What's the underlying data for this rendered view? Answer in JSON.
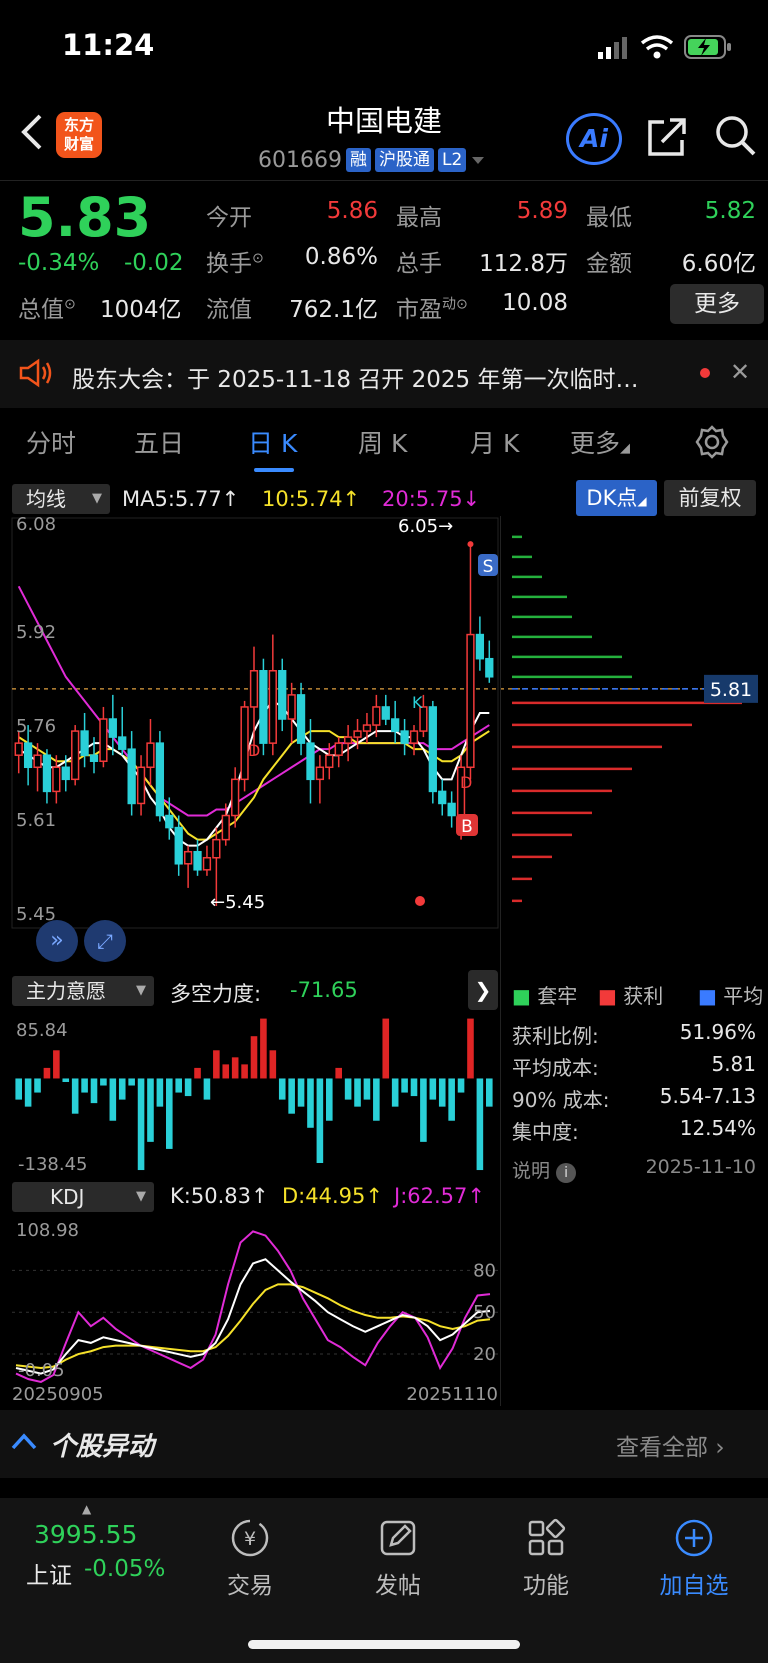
{
  "status": {
    "time": "11:24"
  },
  "header": {
    "logo_line1": "东方",
    "logo_line2": "财富",
    "title": "中国电建",
    "code": "601669",
    "tags": [
      "融",
      "沪股通",
      "L2"
    ],
    "ai_label": "Ai"
  },
  "quote": {
    "price": "5.83",
    "change_pct": "-0.34%",
    "change": "-0.02",
    "mktcap_label": "总值",
    "mktcap_value": "1004亿",
    "open_label": "今开",
    "open_value": "5.86",
    "high_label": "最高",
    "high_value": "5.89",
    "low_label": "最低",
    "low_value": "5.82",
    "turnover_label": "换手",
    "turnover_value": "0.86%",
    "volume_label": "总手",
    "volume_value": "112.8万",
    "amount_label": "金额",
    "amount_value": "6.60亿",
    "float_label": "流值",
    "float_value": "762.1亿",
    "pe_label": "市盈",
    "pe_sup": "动",
    "pe_value": "10.08",
    "more_label": "更多"
  },
  "announcement": {
    "text": "股东大会：于 2025-11-18 召开 2025 年第一次临时…"
  },
  "tabs": [
    "分时",
    "五日",
    "日 K",
    "周 K",
    "月 K",
    "更多"
  ],
  "active_tab": "日 K",
  "ma_row": {
    "indicator": "均线",
    "ma5": "MA5:5.77↑",
    "ma10": "10:5.74↑",
    "ma20": "20:5.75↓",
    "dk_label": "DK点",
    "fq_label": "前复权"
  },
  "main_chart_labels": {
    "y_ticks": [
      "6.08",
      "5.92",
      "5.76",
      "5.61",
      "5.45"
    ],
    "high_marker": "6.05→",
    "low_marker": "←5.45",
    "avg_cost_tag": "5.81",
    "k_marker": "K",
    "d_marker": "D",
    "s_marker": "S",
    "b_marker": "B"
  },
  "chart_data": {
    "type": "candlestick",
    "dates": [
      "20250905",
      "20251110"
    ],
    "ylim": [
      5.45,
      6.08
    ],
    "ohlc": [
      [
        5.7,
        5.74,
        5.67,
        5.72
      ],
      [
        5.72,
        5.75,
        5.65,
        5.68
      ],
      [
        5.68,
        5.72,
        5.64,
        5.7
      ],
      [
        5.7,
        5.71,
        5.62,
        5.64
      ],
      [
        5.64,
        5.7,
        5.62,
        5.68
      ],
      [
        5.68,
        5.7,
        5.64,
        5.66
      ],
      [
        5.66,
        5.75,
        5.65,
        5.74
      ],
      [
        5.74,
        5.77,
        5.68,
        5.7
      ],
      [
        5.7,
        5.73,
        5.67,
        5.69
      ],
      [
        5.69,
        5.78,
        5.68,
        5.76
      ],
      [
        5.76,
        5.8,
        5.7,
        5.73
      ],
      [
        5.73,
        5.78,
        5.7,
        5.71
      ],
      [
        5.71,
        5.74,
        5.6,
        5.62
      ],
      [
        5.62,
        5.7,
        5.6,
        5.68
      ],
      [
        5.68,
        5.76,
        5.65,
        5.72
      ],
      [
        5.72,
        5.74,
        5.59,
        5.6
      ],
      [
        5.6,
        5.63,
        5.56,
        5.58
      ],
      [
        5.58,
        5.6,
        5.5,
        5.52
      ],
      [
        5.52,
        5.55,
        5.48,
        5.54
      ],
      [
        5.54,
        5.56,
        5.5,
        5.51
      ],
      [
        5.51,
        5.55,
        5.5,
        5.53
      ],
      [
        5.53,
        5.58,
        5.45,
        5.56
      ],
      [
        5.56,
        5.62,
        5.55,
        5.6
      ],
      [
        5.6,
        5.68,
        5.58,
        5.66
      ],
      [
        5.66,
        5.79,
        5.64,
        5.78
      ],
      [
        5.78,
        5.88,
        5.7,
        5.84
      ],
      [
        5.84,
        5.86,
        5.7,
        5.72
      ],
      [
        5.72,
        5.9,
        5.7,
        5.84
      ],
      [
        5.84,
        5.86,
        5.74,
        5.76
      ],
      [
        5.76,
        5.82,
        5.72,
        5.8
      ],
      [
        5.8,
        5.82,
        5.7,
        5.72
      ],
      [
        5.72,
        5.76,
        5.62,
        5.66
      ],
      [
        5.66,
        5.7,
        5.62,
        5.68
      ],
      [
        5.68,
        5.72,
        5.66,
        5.7
      ],
      [
        5.7,
        5.73,
        5.68,
        5.72
      ],
      [
        5.72,
        5.75,
        5.69,
        5.73
      ],
      [
        5.73,
        5.76,
        5.71,
        5.74
      ],
      [
        5.74,
        5.77,
        5.72,
        5.75
      ],
      [
        5.75,
        5.8,
        5.73,
        5.78
      ],
      [
        5.78,
        5.8,
        5.75,
        5.76
      ],
      [
        5.76,
        5.79,
        5.72,
        5.74
      ],
      [
        5.74,
        5.76,
        5.7,
        5.72
      ],
      [
        5.72,
        5.75,
        5.7,
        5.74
      ],
      [
        5.74,
        5.8,
        5.73,
        5.78
      ],
      [
        5.78,
        5.79,
        5.62,
        5.64
      ],
      [
        5.64,
        5.66,
        5.6,
        5.62
      ],
      [
        5.62,
        5.64,
        5.58,
        5.6
      ],
      [
        5.6,
        5.7,
        5.56,
        5.68
      ],
      [
        5.68,
        6.05,
        5.66,
        5.9
      ],
      [
        5.9,
        5.93,
        5.84,
        5.86
      ],
      [
        5.86,
        5.89,
        5.82,
        5.83
      ]
    ],
    "ma5": [
      5.71,
      5.7,
      5.69,
      5.68,
      5.68,
      5.69,
      5.7,
      5.71,
      5.72,
      5.72,
      5.71,
      5.7,
      5.68,
      5.66,
      5.63,
      5.61,
      5.58,
      5.56,
      5.55,
      5.55,
      5.56,
      5.58,
      5.6,
      5.64,
      5.69,
      5.74,
      5.77,
      5.79,
      5.78,
      5.76,
      5.74,
      5.72,
      5.71,
      5.7,
      5.7,
      5.71,
      5.72,
      5.73,
      5.74,
      5.74,
      5.74,
      5.73,
      5.73,
      5.71,
      5.68,
      5.66,
      5.66,
      5.7,
      5.74,
      5.77,
      5.77
    ],
    "ma10": [
      5.73,
      5.72,
      5.71,
      5.7,
      5.69,
      5.69,
      5.69,
      5.7,
      5.7,
      5.71,
      5.71,
      5.7,
      5.69,
      5.67,
      5.65,
      5.63,
      5.61,
      5.59,
      5.57,
      5.56,
      5.56,
      5.57,
      5.58,
      5.59,
      5.61,
      5.63,
      5.66,
      5.68,
      5.7,
      5.72,
      5.73,
      5.74,
      5.74,
      5.74,
      5.73,
      5.73,
      5.72,
      5.72,
      5.72,
      5.72,
      5.72,
      5.72,
      5.71,
      5.71,
      5.7,
      5.69,
      5.69,
      5.7,
      5.72,
      5.73,
      5.74
    ],
    "ma20": [
      5.98,
      5.95,
      5.92,
      5.89,
      5.86,
      5.83,
      5.81,
      5.79,
      5.77,
      5.75,
      5.73,
      5.71,
      5.69,
      5.67,
      5.65,
      5.63,
      5.62,
      5.61,
      5.6,
      5.6,
      5.6,
      5.61,
      5.61,
      5.62,
      5.63,
      5.64,
      5.65,
      5.66,
      5.67,
      5.68,
      5.69,
      5.7,
      5.71,
      5.71,
      5.72,
      5.72,
      5.72,
      5.72,
      5.72,
      5.72,
      5.72,
      5.72,
      5.72,
      5.72,
      5.71,
      5.71,
      5.71,
      5.72,
      5.73,
      5.74,
      5.75
    ],
    "force_values": [
      -30,
      -40,
      -20,
      15,
      40,
      -5,
      -50,
      -20,
      -35,
      -10,
      -60,
      -30,
      -10,
      -130,
      -90,
      -40,
      -100,
      -20,
      -25,
      15,
      -30,
      40,
      20,
      30,
      20,
      60,
      85,
      40,
      -30,
      -50,
      -40,
      -70,
      -120,
      -60,
      15,
      -30,
      -40,
      -30,
      -60,
      85,
      -40,
      -20,
      -25,
      -90,
      -30,
      -40,
      -60,
      -20,
      85,
      -130,
      -40
    ],
    "force_ylim": [
      -138.45,
      85.84
    ],
    "kdj": {
      "k": [
        10,
        8,
        6,
        9,
        20,
        30,
        28,
        32,
        30,
        28,
        26,
        24,
        22,
        20,
        18,
        20,
        28,
        45,
        70,
        85,
        88,
        80,
        72,
        65,
        58,
        50,
        45,
        40,
        36,
        40,
        44,
        48,
        46,
        40,
        30,
        34,
        42,
        50,
        51
      ],
      "d": [
        12,
        11,
        10,
        11,
        16,
        20,
        22,
        25,
        26,
        26,
        26,
        25,
        24,
        23,
        22,
        22,
        25,
        33,
        44,
        56,
        66,
        70,
        70,
        68,
        64,
        60,
        55,
        51,
        48,
        46,
        46,
        47,
        46,
        44,
        40,
        38,
        40,
        44,
        45
      ],
      "j": [
        6,
        2,
        0,
        5,
        28,
        50,
        40,
        46,
        38,
        32,
        26,
        22,
        18,
        14,
        10,
        16,
        34,
        70,
        100,
        108,
        105,
        94,
        80,
        60,
        45,
        30,
        25,
        18,
        12,
        28,
        40,
        50,
        46,
        32,
        10,
        24,
        46,
        62,
        63
      ],
      "ylim": [
        -0.05,
        108.98
      ],
      "ref_lines": [
        20,
        50,
        80
      ]
    },
    "chip_distribution": {
      "profit_bars": [
        230,
        180,
        150,
        120,
        100,
        80,
        60,
        40,
        20,
        10
      ],
      "loss_bars": [
        10,
        20,
        30,
        55,
        60,
        80,
        110,
        120
      ]
    }
  },
  "force_panel": {
    "indicator": "主力意愿",
    "label": "多空力度:",
    "value": "-71.65",
    "y_top": "85.84",
    "y_bottom": "-138.45"
  },
  "kdj_panel": {
    "indicator": "KDJ",
    "k": "K:50.83↑",
    "d": "D:44.95↑",
    "j": "J:62.57↑",
    "y_top": "108.98",
    "y_bottom": "-0.05",
    "l80": "80",
    "l50": "50",
    "l20": "20",
    "date_start": "20250905",
    "date_end": "20251110"
  },
  "chip_panel": {
    "legend_trapped": "套牢",
    "legend_profit": "获利",
    "legend_avg": "平均",
    "rows": [
      {
        "label": "获利比例:",
        "value": "51.96%"
      },
      {
        "label": "平均成本:",
        "value": "5.81"
      },
      {
        "label": "90% 成本:",
        "value": "5.54-7.13"
      },
      {
        "label": "集中度:",
        "value": "12.54%"
      }
    ],
    "note_label": "说明",
    "date": "2025-11-10"
  },
  "news": {
    "title": "个股异动",
    "view_all": "查看全部"
  },
  "bottom_nav": {
    "index_value": "3995.55",
    "index_name": "上证",
    "index_change": "-0.05%",
    "items": [
      "交易",
      "发帖",
      "功能",
      "加自选"
    ]
  }
}
